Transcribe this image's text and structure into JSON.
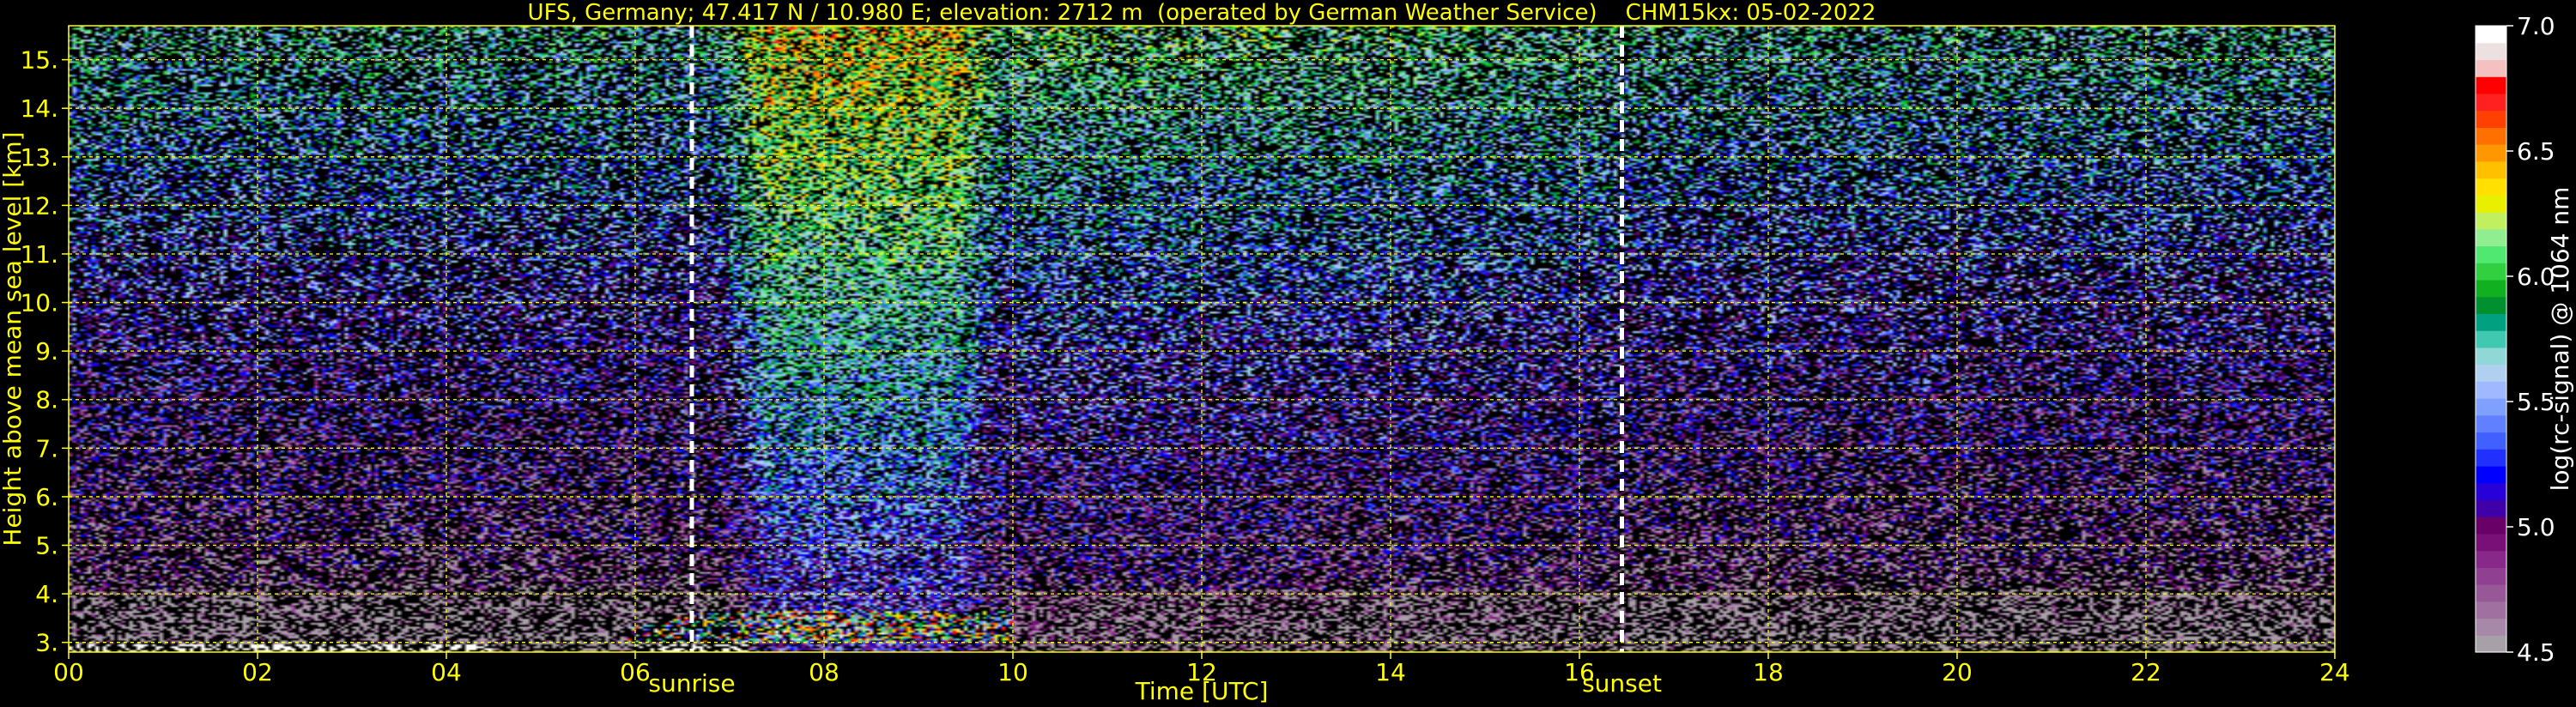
{
  "chart_data": {
    "type": "heatmap",
    "title": "UFS, Germany; 47.417 N / 10.980 E; elevation: 2712 m  (operated by German Weather Service)    CHM15kx: 05-02-2022",
    "xlabel": "Time [UTC]",
    "ylabel": "Height above mean sea level [km]",
    "xlim": [
      0,
      24
    ],
    "ylim": [
      2.8,
      15.7
    ],
    "x_ticks": [
      {
        "value": 0,
        "label": "00"
      },
      {
        "value": 2,
        "label": "02"
      },
      {
        "value": 4,
        "label": "04"
      },
      {
        "value": 6,
        "label": "06"
      },
      {
        "value": 8,
        "label": "08"
      },
      {
        "value": 10,
        "label": "10"
      },
      {
        "value": 12,
        "label": "12"
      },
      {
        "value": 14,
        "label": "14"
      },
      {
        "value": 16,
        "label": "16"
      },
      {
        "value": 18,
        "label": "18"
      },
      {
        "value": 20,
        "label": "20"
      },
      {
        "value": 22,
        "label": "22"
      },
      {
        "value": 24,
        "label": "24"
      }
    ],
    "y_ticks": [
      {
        "value": 3,
        "label": "3."
      },
      {
        "value": 4,
        "label": "4."
      },
      {
        "value": 5,
        "label": "5."
      },
      {
        "value": 6,
        "label": "6."
      },
      {
        "value": 7,
        "label": "7."
      },
      {
        "value": 8,
        "label": "8."
      },
      {
        "value": 9,
        "label": "9."
      },
      {
        "value": 10,
        "label": "10."
      },
      {
        "value": 11,
        "label": "11."
      },
      {
        "value": 12,
        "label": "12."
      },
      {
        "value": 13,
        "label": "13."
      },
      {
        "value": 14,
        "label": "14."
      },
      {
        "value": 15,
        "label": "15."
      }
    ],
    "grid": true,
    "annotations": [
      {
        "label": "sunrise",
        "x": 6.6
      },
      {
        "label": "sunset",
        "x": 16.45
      }
    ],
    "colorbar": {
      "label": "log(rc-signal) @ 1064 nm",
      "range": [
        4.5,
        7.0
      ],
      "ticks": [
        {
          "value": 4.5,
          "label": "4.5"
        },
        {
          "value": 5.0,
          "label": "5.0"
        },
        {
          "value": 5.5,
          "label": "5.5"
        },
        {
          "value": 6.0,
          "label": "6.0"
        },
        {
          "value": 6.5,
          "label": "6.5"
        },
        {
          "value": 7.0,
          "label": "7.0"
        }
      ],
      "colors": [
        "#a8a0a8",
        "#a888a8",
        "#a070a0",
        "#985898",
        "#904090",
        "#882888",
        "#781078",
        "#680068",
        "#4000a8",
        "#2800d8",
        "#0000ff",
        "#2030ff",
        "#4060ff",
        "#6080ff",
        "#80a0ff",
        "#a0b8ff",
        "#b0d0f0",
        "#90d8d8",
        "#40c8b0",
        "#00a080",
        "#009030",
        "#10b020",
        "#30d040",
        "#50e870",
        "#90ee90",
        "#c0f060",
        "#e8f000",
        "#ffe000",
        "#ffc000",
        "#ff9800",
        "#ff7000",
        "#ff4000",
        "#ff2020",
        "#ff0000",
        "#f4c0c0",
        "#ece0e0",
        "#ffffff"
      ]
    }
  },
  "colors": {
    "axis_text": "#ffff00",
    "grid": "#ffff00",
    "background": "#000000",
    "marker_lines": "#ffffff",
    "colorbar_text": "#ffffff"
  }
}
